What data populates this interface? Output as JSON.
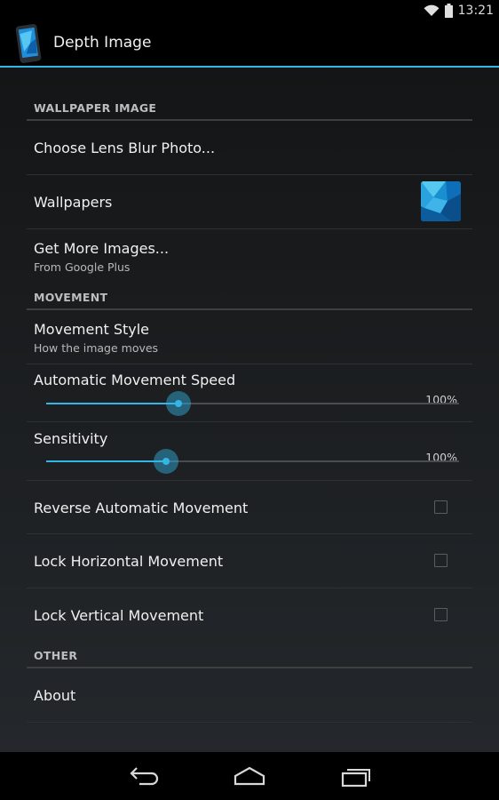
{
  "status_bar": {
    "time": "13:21",
    "icons": [
      "wifi-icon",
      "battery-icon"
    ]
  },
  "action_bar": {
    "title": "Depth Image",
    "icon": "depth-image-app-icon"
  },
  "sections": {
    "wallpaper_image": {
      "header": "WALLPAPER IMAGE",
      "choose_lens_blur": {
        "title": "Choose Lens Blur Photo..."
      },
      "wallpapers": {
        "title": "Wallpapers",
        "thumbnail": "wallpaper-thumbnail"
      },
      "get_more": {
        "title": "Get More Images...",
        "summary": "From Google Plus"
      }
    },
    "movement": {
      "header": "MOVEMENT",
      "movement_style": {
        "title": "Movement Style",
        "summary": "How the image moves"
      },
      "auto_speed": {
        "title": "Automatic Movement Speed",
        "value_label": "100%",
        "fill_fraction": 0.32
      },
      "sensitivity": {
        "title": "Sensitivity",
        "value_label": "100%",
        "fill_fraction": 0.29
      },
      "reverse_auto": {
        "title": "Reverse Automatic Movement",
        "checked": false
      },
      "lock_horizontal": {
        "title": "Lock Horizontal Movement",
        "checked": false
      },
      "lock_vertical": {
        "title": "Lock Vertical Movement",
        "checked": false
      }
    },
    "other": {
      "header": "OTHER",
      "about": {
        "title": "About"
      }
    }
  },
  "nav_bar": {
    "buttons": [
      "back-icon",
      "home-icon",
      "recents-icon"
    ]
  },
  "colors": {
    "accent": "#33b5e5",
    "background": "#000000"
  }
}
